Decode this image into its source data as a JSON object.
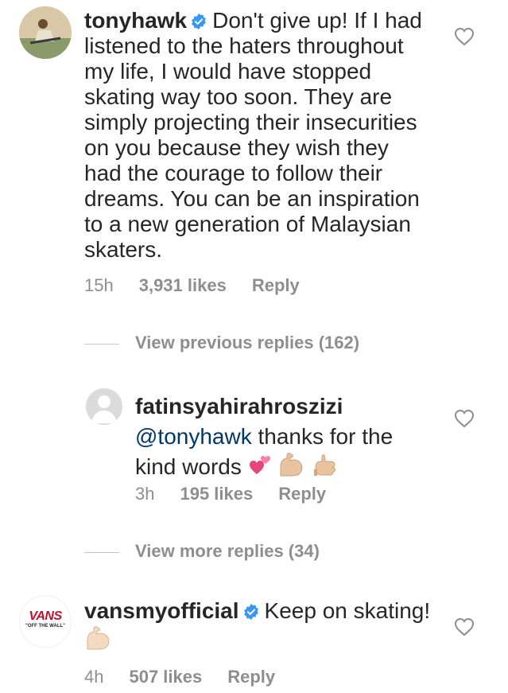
{
  "comments": [
    {
      "username": "tonyhawk",
      "verified": true,
      "text": "Don't give up! If I had listened to the haters throughout my life, I would have stopped skating way too soon. They are simply projecting their insecurities on you because they wish they had the courage to follow their dreams. You can be an inspiration to a new generation of Malaysian skaters.",
      "time": "15h",
      "likes": "3,931 likes",
      "reply_label": "Reply"
    },
    {
      "username": "fatinsyahirahroszizi",
      "mention": "@tonyhawk",
      "text": "thanks for the kind words",
      "emojis": [
        "two-hearts",
        "flexed-biceps",
        "call-me-hand"
      ],
      "time": "3h",
      "likes": "195 likes",
      "reply_label": "Reply"
    },
    {
      "username": "vansmyofficial",
      "verified": true,
      "text": "Keep on skating!",
      "emojis": [
        "flexed-biceps"
      ],
      "time": "4h",
      "likes": "507 likes",
      "reply_label": "Reply",
      "avatar_logo": "VANS",
      "avatar_tagline": "\"OFF THE WALL\""
    }
  ],
  "view_previous": "View previous replies (162)",
  "view_more": "View more replies (34)",
  "colors": {
    "text": "#262626",
    "secondary": "#8e8e8e",
    "mention": "#00376b",
    "verified": "#3897f0",
    "vans_red": "#c8102e"
  }
}
